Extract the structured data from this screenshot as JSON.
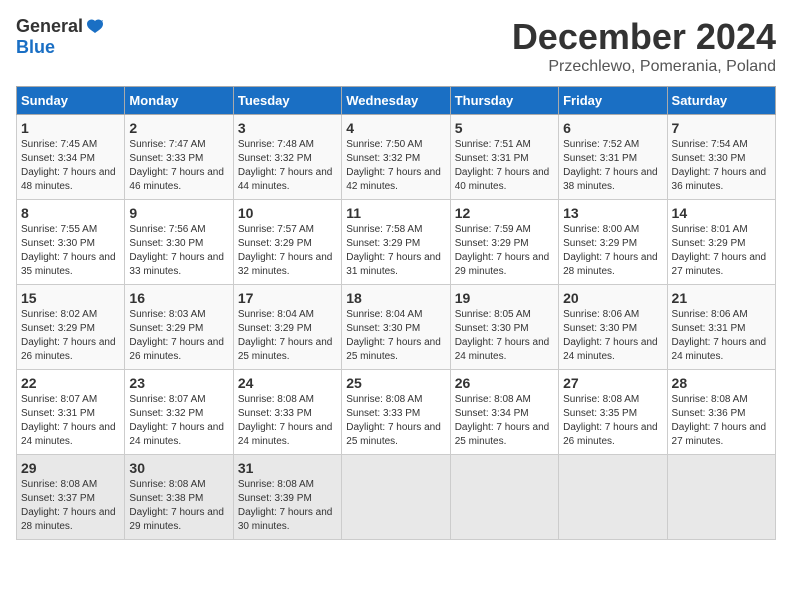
{
  "header": {
    "logo_general": "General",
    "logo_blue": "Blue",
    "title": "December 2024",
    "location": "Przechlewo, Pomerania, Poland"
  },
  "days_of_week": [
    "Sunday",
    "Monday",
    "Tuesday",
    "Wednesday",
    "Thursday",
    "Friday",
    "Saturday"
  ],
  "weeks": [
    [
      {
        "day": "1",
        "rise": "7:45 AM",
        "set": "3:34 PM",
        "daylight": "7 hours and 48 minutes."
      },
      {
        "day": "2",
        "rise": "7:47 AM",
        "set": "3:33 PM",
        "daylight": "7 hours and 46 minutes."
      },
      {
        "day": "3",
        "rise": "7:48 AM",
        "set": "3:32 PM",
        "daylight": "7 hours and 44 minutes."
      },
      {
        "day": "4",
        "rise": "7:50 AM",
        "set": "3:32 PM",
        "daylight": "7 hours and 42 minutes."
      },
      {
        "day": "5",
        "rise": "7:51 AM",
        "set": "3:31 PM",
        "daylight": "7 hours and 40 minutes."
      },
      {
        "day": "6",
        "rise": "7:52 AM",
        "set": "3:31 PM",
        "daylight": "7 hours and 38 minutes."
      },
      {
        "day": "7",
        "rise": "7:54 AM",
        "set": "3:30 PM",
        "daylight": "7 hours and 36 minutes."
      }
    ],
    [
      {
        "day": "8",
        "rise": "7:55 AM",
        "set": "3:30 PM",
        "daylight": "7 hours and 35 minutes."
      },
      {
        "day": "9",
        "rise": "7:56 AM",
        "set": "3:30 PM",
        "daylight": "7 hours and 33 minutes."
      },
      {
        "day": "10",
        "rise": "7:57 AM",
        "set": "3:29 PM",
        "daylight": "7 hours and 32 minutes."
      },
      {
        "day": "11",
        "rise": "7:58 AM",
        "set": "3:29 PM",
        "daylight": "7 hours and 31 minutes."
      },
      {
        "day": "12",
        "rise": "7:59 AM",
        "set": "3:29 PM",
        "daylight": "7 hours and 29 minutes."
      },
      {
        "day": "13",
        "rise": "8:00 AM",
        "set": "3:29 PM",
        "daylight": "7 hours and 28 minutes."
      },
      {
        "day": "14",
        "rise": "8:01 AM",
        "set": "3:29 PM",
        "daylight": "7 hours and 27 minutes."
      }
    ],
    [
      {
        "day": "15",
        "rise": "8:02 AM",
        "set": "3:29 PM",
        "daylight": "7 hours and 26 minutes."
      },
      {
        "day": "16",
        "rise": "8:03 AM",
        "set": "3:29 PM",
        "daylight": "7 hours and 26 minutes."
      },
      {
        "day": "17",
        "rise": "8:04 AM",
        "set": "3:29 PM",
        "daylight": "7 hours and 25 minutes."
      },
      {
        "day": "18",
        "rise": "8:04 AM",
        "set": "3:30 PM",
        "daylight": "7 hours and 25 minutes."
      },
      {
        "day": "19",
        "rise": "8:05 AM",
        "set": "3:30 PM",
        "daylight": "7 hours and 24 minutes."
      },
      {
        "day": "20",
        "rise": "8:06 AM",
        "set": "3:30 PM",
        "daylight": "7 hours and 24 minutes."
      },
      {
        "day": "21",
        "rise": "8:06 AM",
        "set": "3:31 PM",
        "daylight": "7 hours and 24 minutes."
      }
    ],
    [
      {
        "day": "22",
        "rise": "8:07 AM",
        "set": "3:31 PM",
        "daylight": "7 hours and 24 minutes."
      },
      {
        "day": "23",
        "rise": "8:07 AM",
        "set": "3:32 PM",
        "daylight": "7 hours and 24 minutes."
      },
      {
        "day": "24",
        "rise": "8:08 AM",
        "set": "3:33 PM",
        "daylight": "7 hours and 24 minutes."
      },
      {
        "day": "25",
        "rise": "8:08 AM",
        "set": "3:33 PM",
        "daylight": "7 hours and 25 minutes."
      },
      {
        "day": "26",
        "rise": "8:08 AM",
        "set": "3:34 PM",
        "daylight": "7 hours and 25 minutes."
      },
      {
        "day": "27",
        "rise": "8:08 AM",
        "set": "3:35 PM",
        "daylight": "7 hours and 26 minutes."
      },
      {
        "day": "28",
        "rise": "8:08 AM",
        "set": "3:36 PM",
        "daylight": "7 hours and 27 minutes."
      }
    ],
    [
      {
        "day": "29",
        "rise": "8:08 AM",
        "set": "3:37 PM",
        "daylight": "7 hours and 28 minutes."
      },
      {
        "day": "30",
        "rise": "8:08 AM",
        "set": "3:38 PM",
        "daylight": "7 hours and 29 minutes."
      },
      {
        "day": "31",
        "rise": "8:08 AM",
        "set": "3:39 PM",
        "daylight": "7 hours and 30 minutes."
      },
      null,
      null,
      null,
      null
    ]
  ]
}
